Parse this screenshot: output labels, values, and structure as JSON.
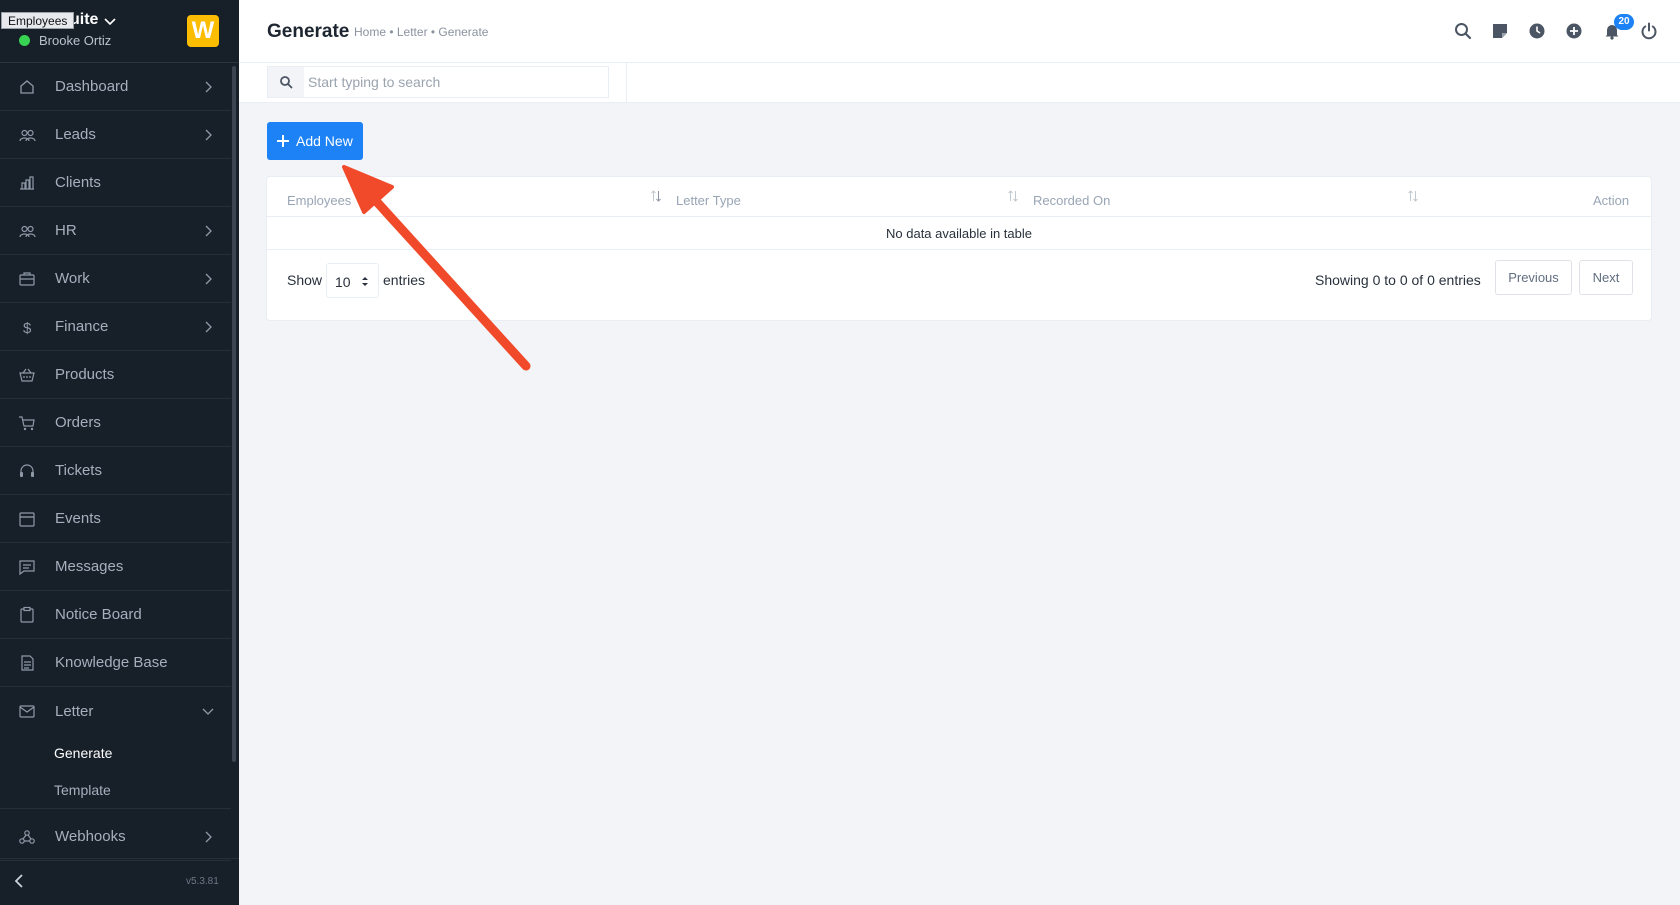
{
  "sidebar": {
    "tooltip": "Employees",
    "company_name": "uite",
    "user_name": "Brooke Ortiz",
    "logo_letter": "W",
    "items": [
      {
        "label": "Dashboard",
        "icon": "house-icon",
        "has_chevron": true
      },
      {
        "label": "Leads",
        "icon": "users-icon",
        "has_chevron": true
      },
      {
        "label": "Clients",
        "icon": "building-icon",
        "has_chevron": false
      },
      {
        "label": "HR",
        "icon": "people-icon",
        "has_chevron": true
      },
      {
        "label": "Work",
        "icon": "briefcase-icon",
        "has_chevron": true
      },
      {
        "label": "Finance",
        "icon": "dollar-icon",
        "has_chevron": true
      },
      {
        "label": "Products",
        "icon": "basket-icon",
        "has_chevron": false
      },
      {
        "label": "Orders",
        "icon": "cart-icon",
        "has_chevron": false
      },
      {
        "label": "Tickets",
        "icon": "headset-icon",
        "has_chevron": false
      },
      {
        "label": "Events",
        "icon": "calendar-icon",
        "has_chevron": false
      },
      {
        "label": "Messages",
        "icon": "chat-icon",
        "has_chevron": false
      },
      {
        "label": "Notice Board",
        "icon": "clipboard-icon",
        "has_chevron": false
      },
      {
        "label": "Knowledge Base",
        "icon": "book-icon",
        "has_chevron": false
      },
      {
        "label": "Letter",
        "icon": "envelope-icon",
        "has_chevron": true,
        "expanded": true
      }
    ],
    "letter_subitems": [
      {
        "label": "Generate",
        "active": true
      },
      {
        "label": "Template",
        "active": false
      }
    ],
    "webhooks": {
      "label": "Webhooks",
      "icon": "webhook-icon"
    },
    "version": "v5.3.81"
  },
  "header": {
    "title": "Generate",
    "breadcrumb": "Home • Letter • Generate",
    "notification_count": "20",
    "icons": [
      "search-icon",
      "sticky-note-icon",
      "clock-icon",
      "plus-circle-icon",
      "bell-icon",
      "power-icon"
    ]
  },
  "search": {
    "placeholder": "Start typing to search"
  },
  "toolbar": {
    "add_label": "Add New"
  },
  "table": {
    "columns": [
      "Employees",
      "Letter Type",
      "Recorded On",
      "Action"
    ],
    "empty_message": "No data available in table",
    "show_label": "Show",
    "entries_value": "10",
    "entries_label": "entries",
    "info": "Showing 0 to 0 of 0 entries",
    "prev_label": "Previous",
    "next_label": "Next"
  },
  "colors": {
    "accent": "#1d82f5",
    "sidebar_bg": "#171f29",
    "logo": "#fcbd01",
    "annotation_arrow": "#f04a2a"
  }
}
